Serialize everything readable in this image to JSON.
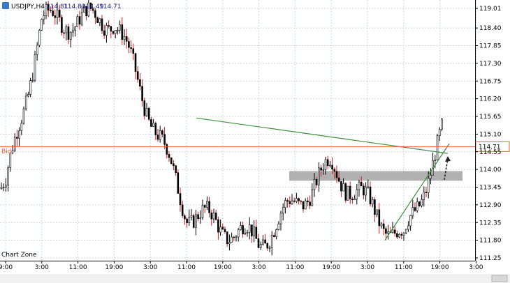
{
  "header": {
    "symbol": "USDJPY,H4",
    "open": "114.81",
    "high": "114.83",
    "low": "114.49",
    "close": "114.71"
  },
  "watermark": "Chart Zone",
  "bid_label": "Bid",
  "colors": {
    "background": "#ffffff",
    "grid": "#c9d8e8",
    "candle": "#000000",
    "bull_wick": "#000000",
    "bear_wick": "#cc1f1f",
    "bid_line": "#e8632a",
    "trend_line": "#3f8f3f",
    "zone": "#a8a8a8",
    "arrow": "#222222",
    "header_icon": "#3a78c9"
  },
  "chart_data": {
    "type": "candlestick",
    "title": "USDJPY,H4",
    "xlabel": "",
    "ylabel": "",
    "ylim": [
      111.25,
      119.1
    ],
    "y_ticks": [
      "119.01",
      "118.40",
      "117.85",
      "117.30",
      "116.75",
      "116.20",
      "115.65",
      "115.10",
      "114.55",
      "114.00",
      "113.45",
      "112.90",
      "112.35",
      "111.80",
      "111.25"
    ],
    "x_ticks": [
      "9:00",
      "3:00",
      "11:00",
      "19:00",
      "3:00",
      "11:00",
      "19:00",
      "3:00",
      "11:00",
      "19:00",
      "3:00",
      "11:00",
      "19:00",
      "3:00"
    ],
    "bid": 114.71,
    "bid_tag": "114.71",
    "key_points": [
      {
        "x": "9:00",
        "y": 113.4
      },
      {
        "x": "3:00",
        "y": 118.6
      },
      {
        "x": "19:00",
        "y": 118.7
      },
      {
        "x": "11:00",
        "y": 112.7
      },
      {
        "x": "3:00",
        "y": 111.75
      },
      {
        "x": "19:00",
        "y": 114.1
      },
      {
        "x": "3:00",
        "y": 111.75
      },
      {
        "x": "19:00",
        "y": 115.5
      }
    ],
    "trendline_upper": {
      "from": 115.6,
      "to": 114.5
    },
    "trendline_lower": {
      "from": 111.8,
      "to": 114.8
    },
    "support_zone": [
      113.65,
      113.95
    ]
  }
}
